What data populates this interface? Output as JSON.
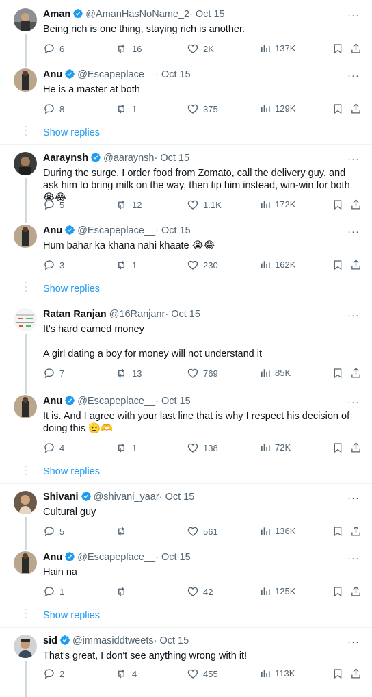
{
  "colors": {
    "accent": "#1d9bf0",
    "muted": "#536471",
    "text": "#0f1419",
    "line": "#cfd9de"
  },
  "tweets": [
    {
      "name": "Aman",
      "verified": true,
      "handle": "@AmanHasNoName_2",
      "dot": "·",
      "date": "Oct 15",
      "text": "Being rich is one thing, staying rich is another.",
      "replies": "6",
      "retweets": "16",
      "likes": "2K",
      "views": "137K"
    },
    {
      "name": "Anu",
      "verified": true,
      "handle": "@Escapeplace__",
      "dot": "·",
      "date": "Oct 15",
      "text": "He is a master at both",
      "replies": "8",
      "retweets": "1",
      "likes": "375",
      "views": "129K"
    },
    {
      "name": "Aaraynsh",
      "verified": true,
      "handle": "@aaraynsh",
      "dot": "·",
      "date": "Oct 15",
      "text": "During the surge, I order food from Zomato, call the delivery guy, and ask him to bring milk on the way, then tip him instead, win-win for both😭😂",
      "replies": "5",
      "retweets": "12",
      "likes": "1.1K",
      "views": "172K"
    },
    {
      "name": "Anu",
      "verified": true,
      "handle": "@Escapeplace__",
      "dot": "·",
      "date": "Oct 15",
      "text": "Hum bahar ka khana nahi khaate 😭😂",
      "replies": "3",
      "retweets": "1",
      "likes": "230",
      "views": "162K"
    },
    {
      "name": "Ratan Ranjan",
      "verified": false,
      "handle": "@16Ranjanr",
      "dot": "·",
      "date": "Oct 15",
      "text": "It's hard earned money\n\nA girl dating a boy for money will not understand it",
      "replies": "7",
      "retweets": "13",
      "likes": "769",
      "views": "85K"
    },
    {
      "name": "Anu",
      "verified": true,
      "handle": "@Escapeplace__",
      "dot": "·",
      "date": "Oct 15",
      "text": "It is. And I agree with your last line that is why I respect his decision of doing this 🫡🫶",
      "replies": "4",
      "retweets": "1",
      "likes": "138",
      "views": "72K"
    },
    {
      "name": "Shivani",
      "verified": true,
      "handle": "@shivani_yaar",
      "dot": "·",
      "date": "Oct 15",
      "text": "Cultural guy",
      "replies": "5",
      "retweets": "",
      "likes": "561",
      "views": "136K"
    },
    {
      "name": "Anu",
      "verified": true,
      "handle": "@Escapeplace__",
      "dot": "·",
      "date": "Oct 15",
      "text": "Hain na",
      "replies": "1",
      "retweets": "",
      "likes": "42",
      "views": "125K"
    },
    {
      "name": "sid",
      "verified": true,
      "handle": "@immasiddtweets",
      "dot": "·",
      "date": "Oct 15",
      "text": "That's great, I don't see anything wrong with it!",
      "replies": "2",
      "retweets": "4",
      "likes": "455",
      "views": "113K"
    }
  ],
  "show_replies_label": "Show replies",
  "more_glyph": "···"
}
